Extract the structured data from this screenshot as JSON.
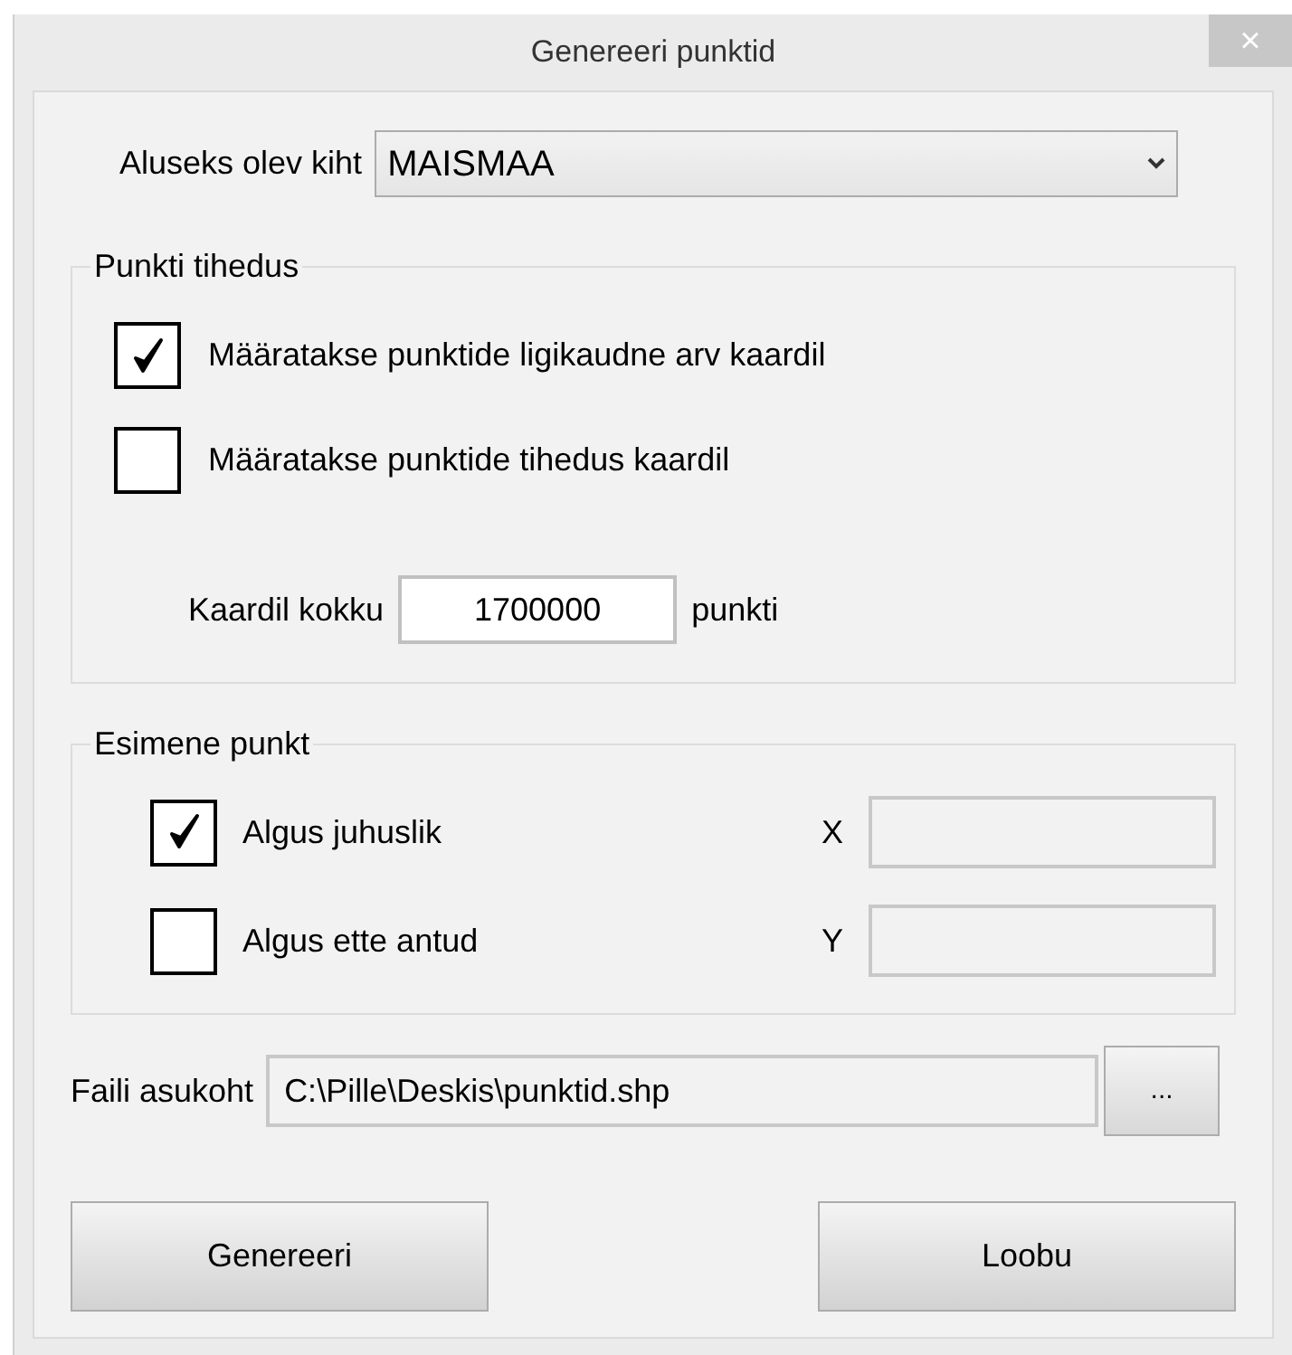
{
  "window": {
    "title": "Genereeri punktid",
    "close": "×"
  },
  "layer": {
    "label": "Aluseks olev kiht",
    "value": "MAISMAA"
  },
  "density": {
    "title": "Punkti tihedus",
    "options": [
      {
        "label": "Määratakse punktide ligikaudne arv kaardil",
        "checked": true
      },
      {
        "label": "Määratakse punktide tihedus kaardil",
        "checked": false
      }
    ],
    "total_label": "Kaardil kokku",
    "total_value": "1700000",
    "total_unit": "punkti"
  },
  "first_point": {
    "title": "Esimene punkt",
    "options": [
      {
        "label": "Algus juhuslik",
        "checked": true,
        "coord": "X"
      },
      {
        "label": "Algus ette antud",
        "checked": false,
        "coord": "Y"
      }
    ]
  },
  "file": {
    "label": "Faili asukoht",
    "value": "C:\\Pille\\Deskis\\punktid.shp",
    "browse": "..."
  },
  "buttons": [
    "Genereeri",
    "Loobu"
  ]
}
